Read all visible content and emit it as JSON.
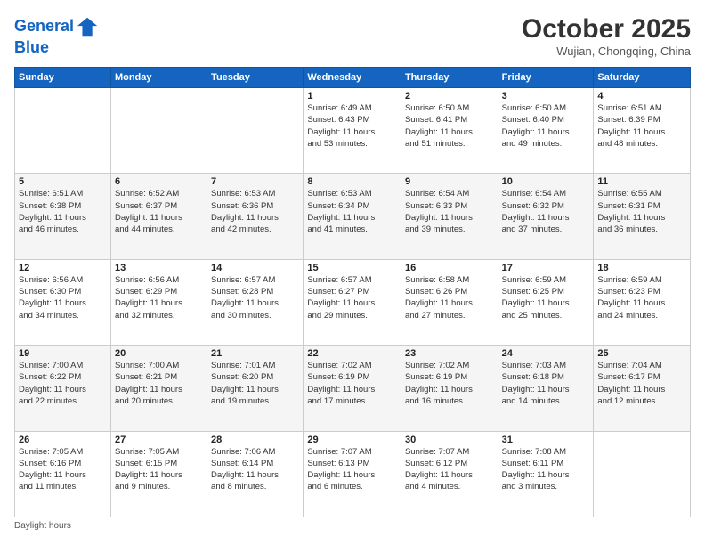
{
  "header": {
    "logo_line1": "General",
    "logo_line2": "Blue",
    "month_title": "October 2025",
    "location": "Wujian, Chongqing, China"
  },
  "days_of_week": [
    "Sunday",
    "Monday",
    "Tuesday",
    "Wednesday",
    "Thursday",
    "Friday",
    "Saturday"
  ],
  "weeks": [
    [
      {
        "day": "",
        "info": ""
      },
      {
        "day": "",
        "info": ""
      },
      {
        "day": "",
        "info": ""
      },
      {
        "day": "1",
        "info": "Sunrise: 6:49 AM\nSunset: 6:43 PM\nDaylight: 11 hours\nand 53 minutes."
      },
      {
        "day": "2",
        "info": "Sunrise: 6:50 AM\nSunset: 6:41 PM\nDaylight: 11 hours\nand 51 minutes."
      },
      {
        "day": "3",
        "info": "Sunrise: 6:50 AM\nSunset: 6:40 PM\nDaylight: 11 hours\nand 49 minutes."
      },
      {
        "day": "4",
        "info": "Sunrise: 6:51 AM\nSunset: 6:39 PM\nDaylight: 11 hours\nand 48 minutes."
      }
    ],
    [
      {
        "day": "5",
        "info": "Sunrise: 6:51 AM\nSunset: 6:38 PM\nDaylight: 11 hours\nand 46 minutes."
      },
      {
        "day": "6",
        "info": "Sunrise: 6:52 AM\nSunset: 6:37 PM\nDaylight: 11 hours\nand 44 minutes."
      },
      {
        "day": "7",
        "info": "Sunrise: 6:53 AM\nSunset: 6:36 PM\nDaylight: 11 hours\nand 42 minutes."
      },
      {
        "day": "8",
        "info": "Sunrise: 6:53 AM\nSunset: 6:34 PM\nDaylight: 11 hours\nand 41 minutes."
      },
      {
        "day": "9",
        "info": "Sunrise: 6:54 AM\nSunset: 6:33 PM\nDaylight: 11 hours\nand 39 minutes."
      },
      {
        "day": "10",
        "info": "Sunrise: 6:54 AM\nSunset: 6:32 PM\nDaylight: 11 hours\nand 37 minutes."
      },
      {
        "day": "11",
        "info": "Sunrise: 6:55 AM\nSunset: 6:31 PM\nDaylight: 11 hours\nand 36 minutes."
      }
    ],
    [
      {
        "day": "12",
        "info": "Sunrise: 6:56 AM\nSunset: 6:30 PM\nDaylight: 11 hours\nand 34 minutes."
      },
      {
        "day": "13",
        "info": "Sunrise: 6:56 AM\nSunset: 6:29 PM\nDaylight: 11 hours\nand 32 minutes."
      },
      {
        "day": "14",
        "info": "Sunrise: 6:57 AM\nSunset: 6:28 PM\nDaylight: 11 hours\nand 30 minutes."
      },
      {
        "day": "15",
        "info": "Sunrise: 6:57 AM\nSunset: 6:27 PM\nDaylight: 11 hours\nand 29 minutes."
      },
      {
        "day": "16",
        "info": "Sunrise: 6:58 AM\nSunset: 6:26 PM\nDaylight: 11 hours\nand 27 minutes."
      },
      {
        "day": "17",
        "info": "Sunrise: 6:59 AM\nSunset: 6:25 PM\nDaylight: 11 hours\nand 25 minutes."
      },
      {
        "day": "18",
        "info": "Sunrise: 6:59 AM\nSunset: 6:23 PM\nDaylight: 11 hours\nand 24 minutes."
      }
    ],
    [
      {
        "day": "19",
        "info": "Sunrise: 7:00 AM\nSunset: 6:22 PM\nDaylight: 11 hours\nand 22 minutes."
      },
      {
        "day": "20",
        "info": "Sunrise: 7:00 AM\nSunset: 6:21 PM\nDaylight: 11 hours\nand 20 minutes."
      },
      {
        "day": "21",
        "info": "Sunrise: 7:01 AM\nSunset: 6:20 PM\nDaylight: 11 hours\nand 19 minutes."
      },
      {
        "day": "22",
        "info": "Sunrise: 7:02 AM\nSunset: 6:19 PM\nDaylight: 11 hours\nand 17 minutes."
      },
      {
        "day": "23",
        "info": "Sunrise: 7:02 AM\nSunset: 6:19 PM\nDaylight: 11 hours\nand 16 minutes."
      },
      {
        "day": "24",
        "info": "Sunrise: 7:03 AM\nSunset: 6:18 PM\nDaylight: 11 hours\nand 14 minutes."
      },
      {
        "day": "25",
        "info": "Sunrise: 7:04 AM\nSunset: 6:17 PM\nDaylight: 11 hours\nand 12 minutes."
      }
    ],
    [
      {
        "day": "26",
        "info": "Sunrise: 7:05 AM\nSunset: 6:16 PM\nDaylight: 11 hours\nand 11 minutes."
      },
      {
        "day": "27",
        "info": "Sunrise: 7:05 AM\nSunset: 6:15 PM\nDaylight: 11 hours\nand 9 minutes."
      },
      {
        "day": "28",
        "info": "Sunrise: 7:06 AM\nSunset: 6:14 PM\nDaylight: 11 hours\nand 8 minutes."
      },
      {
        "day": "29",
        "info": "Sunrise: 7:07 AM\nSunset: 6:13 PM\nDaylight: 11 hours\nand 6 minutes."
      },
      {
        "day": "30",
        "info": "Sunrise: 7:07 AM\nSunset: 6:12 PM\nDaylight: 11 hours\nand 4 minutes."
      },
      {
        "day": "31",
        "info": "Sunrise: 7:08 AM\nSunset: 6:11 PM\nDaylight: 11 hours\nand 3 minutes."
      },
      {
        "day": "",
        "info": ""
      }
    ]
  ],
  "footer": {
    "note": "Daylight hours"
  }
}
